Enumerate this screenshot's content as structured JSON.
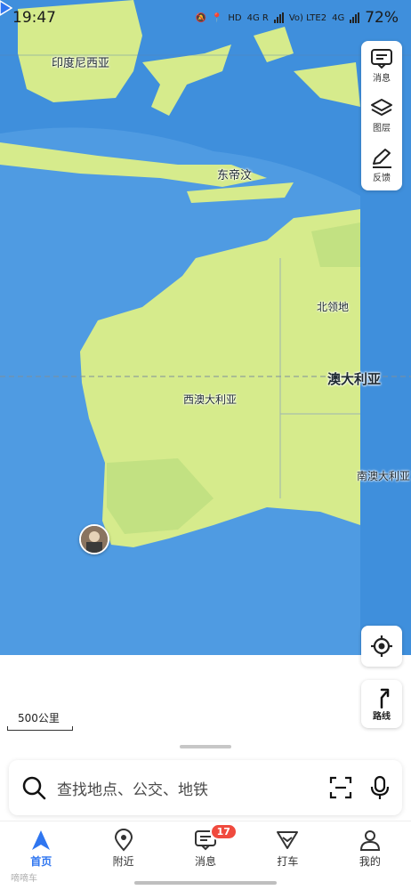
{
  "status_bar": {
    "time": "19:47",
    "indicators": [
      "HD",
      "4G R",
      "Vo) LTE2",
      "4G"
    ],
    "battery": "72%"
  },
  "map": {
    "labels": {
      "indonesia": "印度尼西亚",
      "timor_leste": "东帝汶",
      "northern_territory": "北领地",
      "australia": "澳大利亚",
      "western_australia": "西澳大利亚",
      "south_australia": "南澳大利亚"
    },
    "scale": "500公里",
    "colors": {
      "ocean": "#3f8fdc",
      "land": "#d6eb8c"
    }
  },
  "tools": {
    "messages": "消息",
    "layers": "图层",
    "feedback": "反馈"
  },
  "route_label": "路线",
  "search": {
    "placeholder": "查找地点、公交、地铁"
  },
  "tabbar": {
    "tabs": [
      {
        "label": "首页",
        "icon": "navigation-arrow-icon",
        "active": true
      },
      {
        "label": "附近",
        "icon": "location-pin-icon"
      },
      {
        "label": "消息",
        "icon": "message-icon",
        "badge": "17"
      },
      {
        "label": "打车",
        "icon": "taxi-icon"
      },
      {
        "label": "我的",
        "icon": "person-icon"
      }
    ]
  },
  "watermark": "嘀嘀车"
}
